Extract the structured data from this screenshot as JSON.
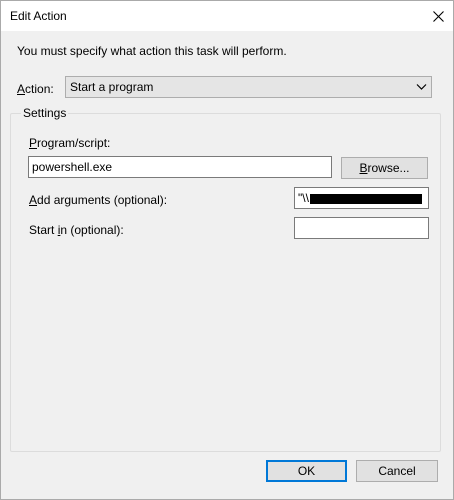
{
  "window": {
    "title": "Edit Action",
    "close_glyph": "✕"
  },
  "dialog": {
    "instruction": "You must specify what action this task will perform.",
    "action": {
      "label_mnemonic": "A",
      "label_rest": "ction:",
      "selected": "Start a program"
    },
    "settings": {
      "group_label": "Settings",
      "program": {
        "label_mnemonic": "P",
        "label_rest": "rogram/script:",
        "value": "powershell.exe",
        "browse_mnemonic": "B",
        "browse_rest": "rowse..."
      },
      "arguments": {
        "label_mnemonic": "A",
        "label_rest": "dd arguments (optional):",
        "value_visible": "\"\\\\"
      },
      "start_in": {
        "label_pre": "Start ",
        "label_mnemonic": "i",
        "label_rest": "n (optional):",
        "value": ""
      }
    },
    "buttons": {
      "ok": "OK",
      "cancel": "Cancel"
    }
  },
  "icons": {
    "close": "close-icon",
    "dropdown": "chevron-down-icon"
  },
  "colors": {
    "client_bg": "#f0f0f0",
    "default_button_border": "#0078d7"
  }
}
